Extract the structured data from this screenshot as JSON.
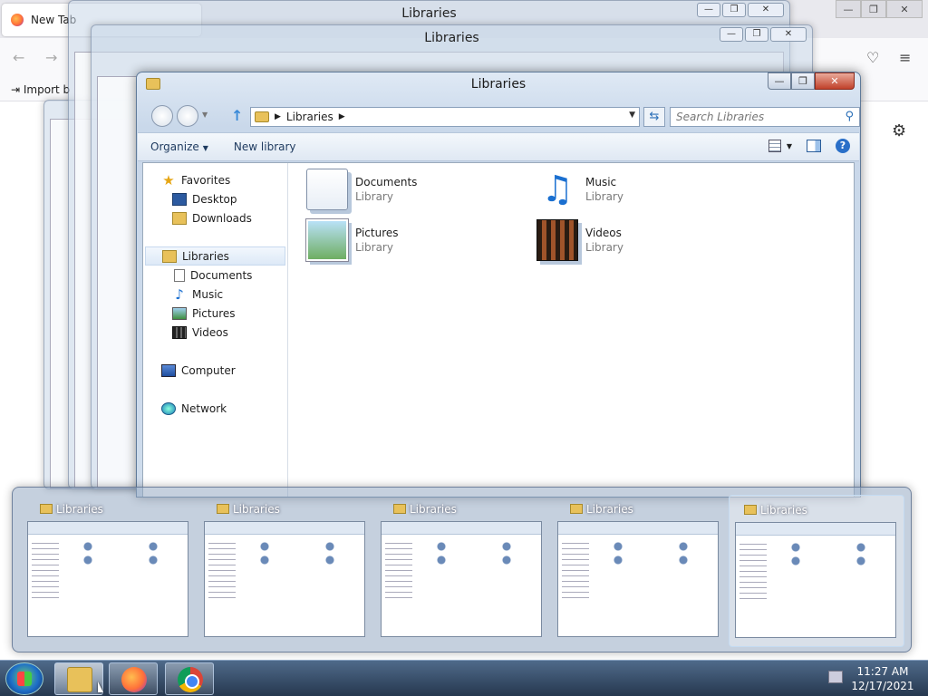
{
  "browser": {
    "tab_title": "New Tab",
    "bookmark_import": "Import b"
  },
  "ghost_windows": [
    {
      "title": "Libraries"
    },
    {
      "title": "Libraries"
    },
    {
      "title": "Libraries"
    }
  ],
  "explorer": {
    "title": "Libraries",
    "address": "Libraries",
    "search_placeholder": "Search Libraries",
    "toolbar": {
      "organize": "Organize",
      "new_library": "New library"
    },
    "nav": {
      "favorites": "Favorites",
      "desktop": "Desktop",
      "downloads": "Downloads",
      "libraries": "Libraries",
      "documents": "Documents",
      "music": "Music",
      "pictures": "Pictures",
      "videos": "Videos",
      "computer": "Computer",
      "network": "Network"
    },
    "items": [
      {
        "name": "Documents",
        "type": "Library",
        "icon": "documents-library-icon"
      },
      {
        "name": "Music",
        "type": "Library",
        "icon": "music-library-icon"
      },
      {
        "name": "Pictures",
        "type": "Library",
        "icon": "pictures-library-icon"
      },
      {
        "name": "Videos",
        "type": "Library",
        "icon": "videos-library-icon"
      }
    ]
  },
  "flip": {
    "thumbnails": [
      {
        "title": "Libraries"
      },
      {
        "title": "Libraries"
      },
      {
        "title": "Libraries"
      },
      {
        "title": "Libraries"
      },
      {
        "title": "Libraries"
      }
    ],
    "selected_index": 4
  },
  "taskbar": {
    "time": "11:27 AM",
    "date": "12/17/2021",
    "apps": [
      "Windows Explorer",
      "Firefox",
      "Chrome"
    ]
  }
}
